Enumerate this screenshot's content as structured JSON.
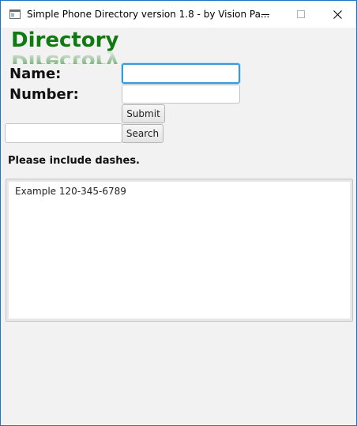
{
  "window": {
    "title": "Simple Phone Directory version 1.8 -  by Vision Pa...",
    "minimize_icon": "minimize-icon",
    "maximize_icon": "maximize-icon",
    "close_icon": "close-icon",
    "app_icon": "app-window-icon"
  },
  "header": {
    "title": "Directory",
    "color": "#107a10"
  },
  "form": {
    "name_label": "Name:",
    "number_label": "Number:",
    "name_value": "",
    "number_value": "",
    "submit_label": "Submit"
  },
  "search": {
    "value": "",
    "button_label": "Search"
  },
  "hint": "Please include dashes.",
  "output": {
    "text": "Example 120-345-6789"
  }
}
